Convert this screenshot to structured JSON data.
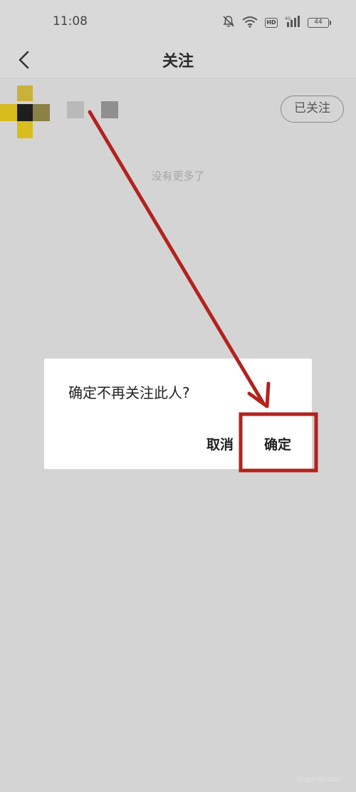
{
  "status_bar": {
    "time": "11:08",
    "battery": "44",
    "hd": "HD",
    "icons": [
      "mute-bell-icon",
      "wifi-icon",
      "hd-icon",
      "signal-icon",
      "battery-icon"
    ]
  },
  "nav": {
    "title": "关注",
    "back_icon": "chevron-left-icon"
  },
  "list": {
    "items": [
      {
        "follow_label": "已关注"
      }
    ],
    "end_text": "没有更多了"
  },
  "dialog": {
    "message": "确定不再关注此人?",
    "cancel_label": "取消",
    "confirm_label": "确定"
  },
  "annotation": {
    "color": "#b3221d"
  },
  "watermark": "jingyanla.com"
}
